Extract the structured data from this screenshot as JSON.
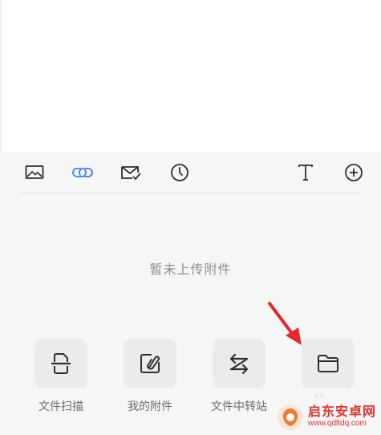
{
  "toolbar": {
    "icons": [
      "image-icon",
      "link-icon",
      "mail-check-icon",
      "clock-icon",
      "text-icon",
      "plus-circle-icon"
    ],
    "active_color": "#3a7cf6",
    "icon_color": "#2f2f33"
  },
  "attachments": {
    "empty_text": "暂未上传附件"
  },
  "actions": [
    {
      "label": "文件扫描",
      "icon": "scan-document-icon"
    },
    {
      "label": "我的附件",
      "icon": "attachment-edit-icon"
    },
    {
      "label": "文件中转站",
      "icon": "transfer-arrows-icon"
    },
    {
      "label": "",
      "icon": "folder-icon"
    }
  ],
  "annotation": {
    "color": "#e8262c"
  },
  "watermark": {
    "title": "启东安卓网",
    "url": "www.qdltdq.com",
    "color": "#e0322b"
  }
}
